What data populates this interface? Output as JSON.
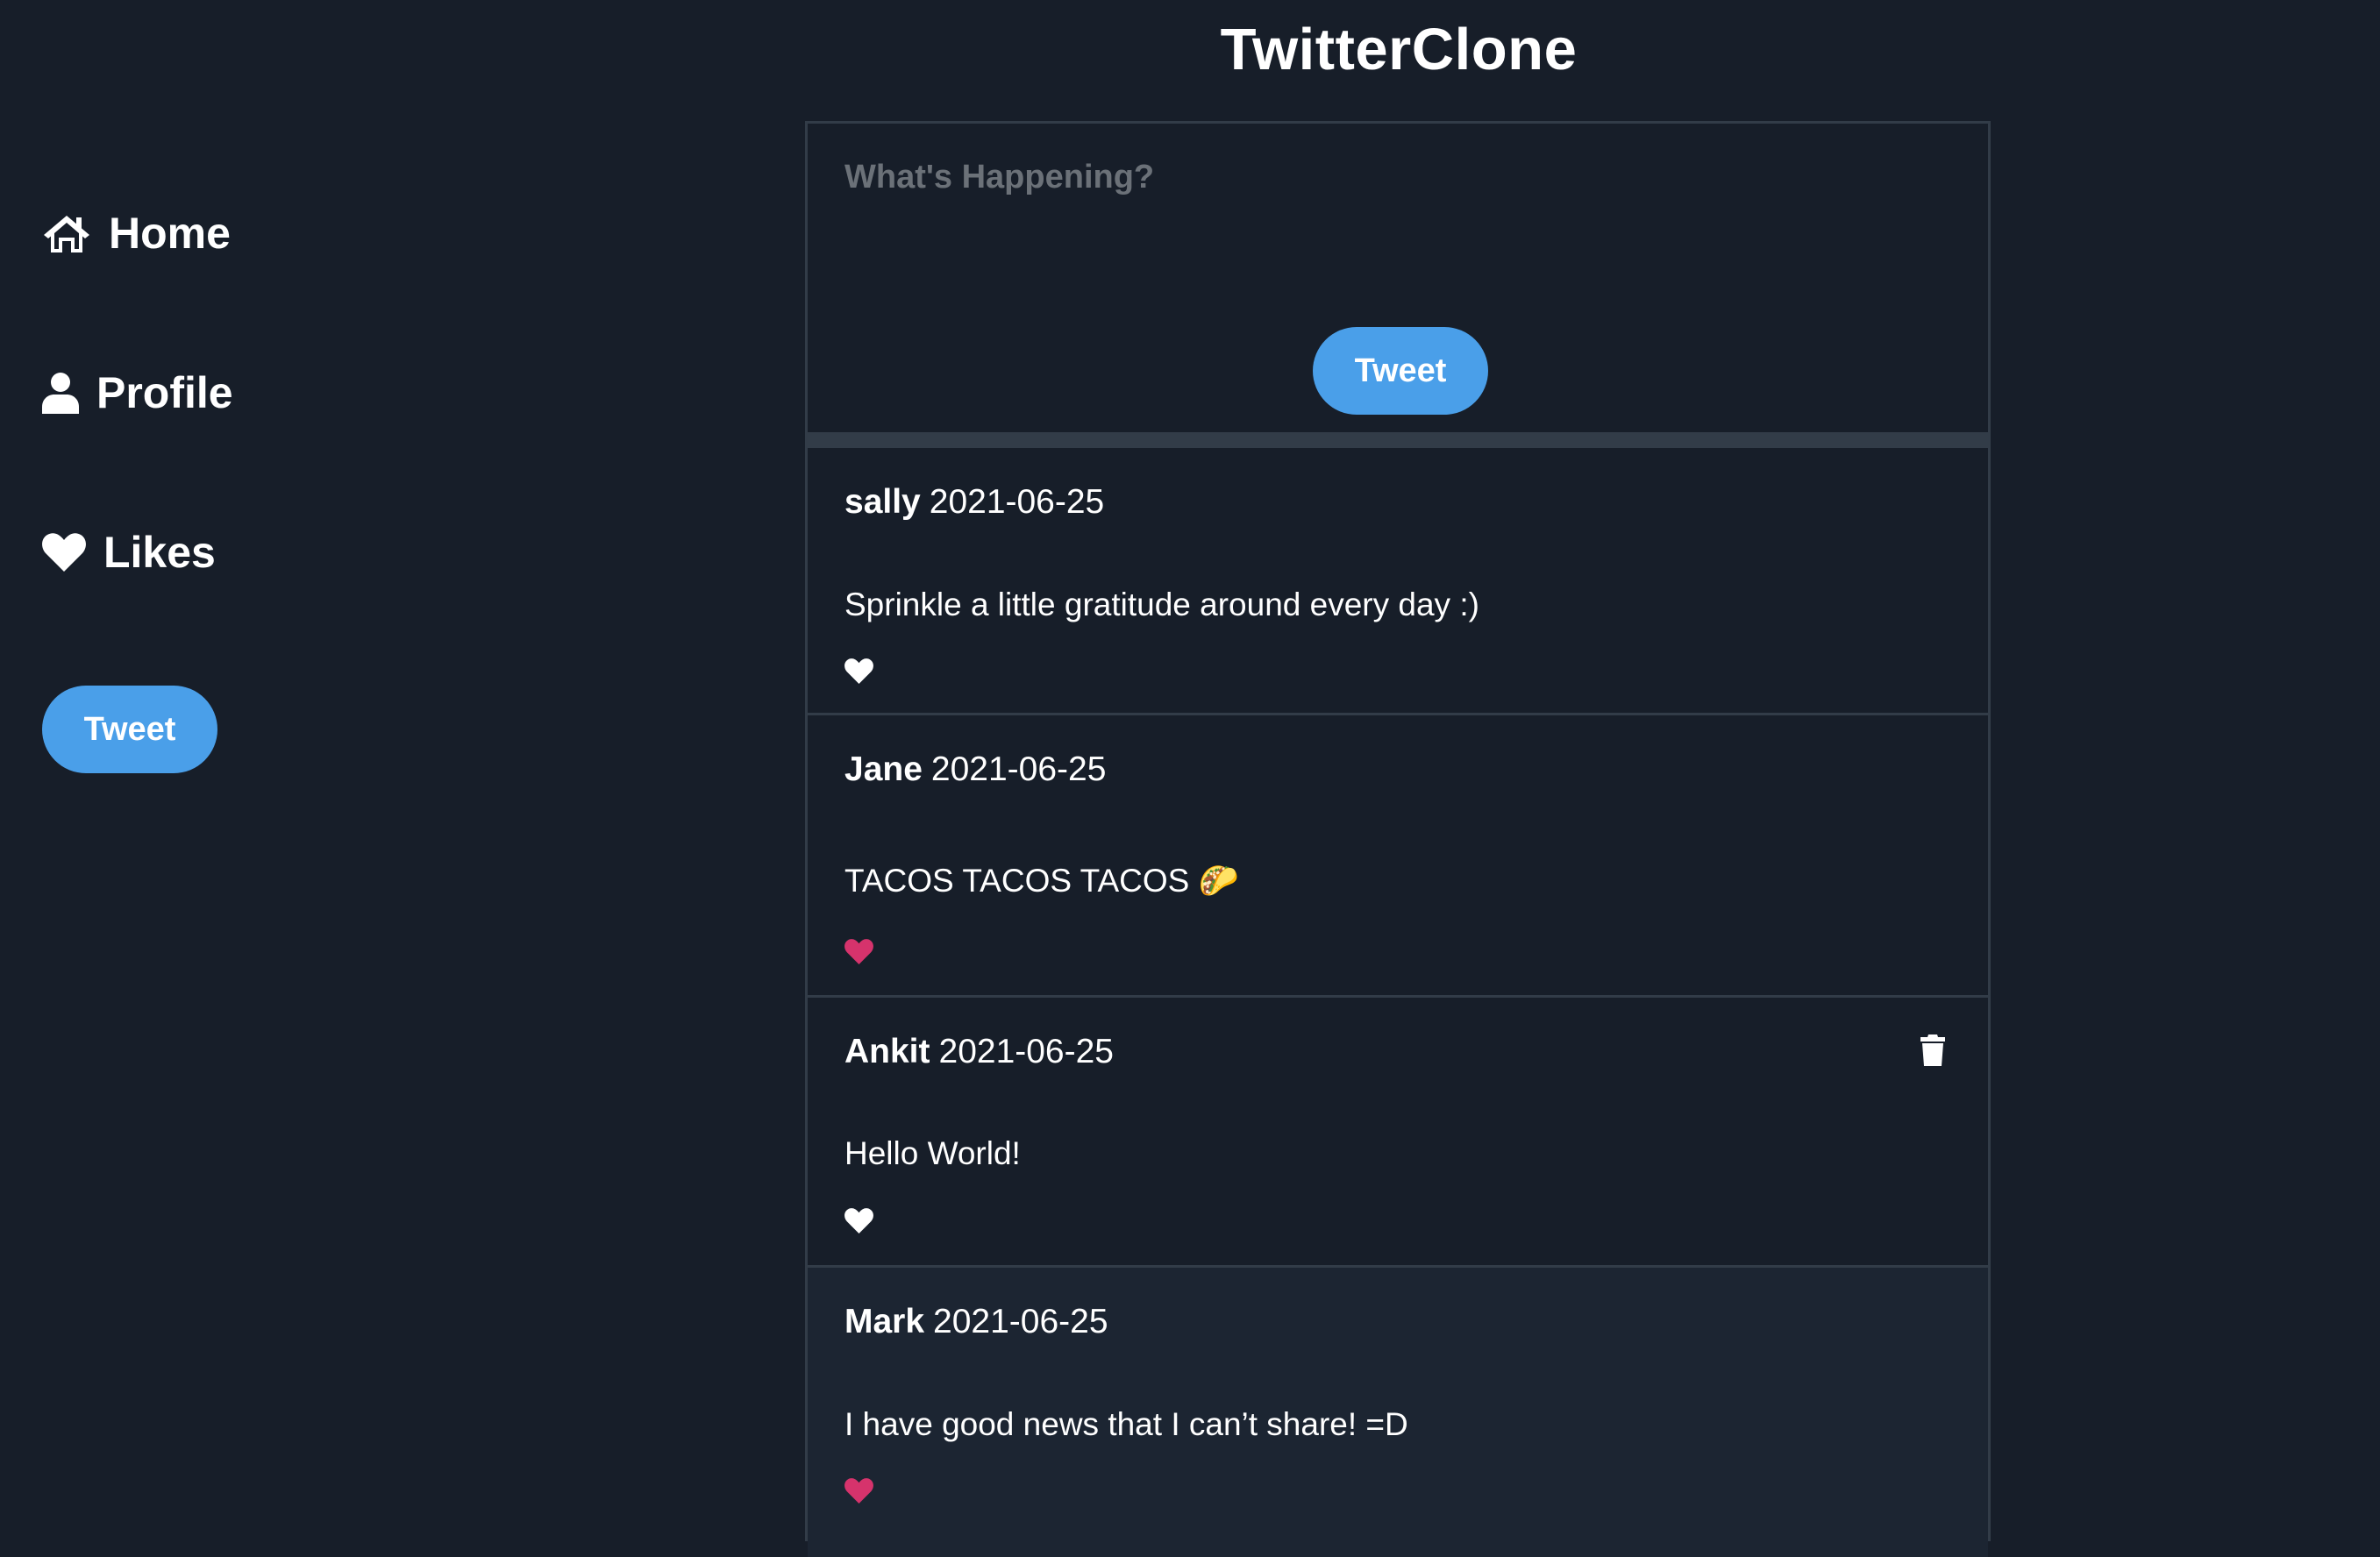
{
  "app": {
    "title": "TwitterClone"
  },
  "sidebar": {
    "items": [
      {
        "label": "Home",
        "icon": "home-icon"
      },
      {
        "label": "Profile",
        "icon": "user-icon"
      },
      {
        "label": "Likes",
        "icon": "heart-icon"
      }
    ],
    "tweet_button": "Tweet"
  },
  "composer": {
    "placeholder": "What's Happening?",
    "value": "",
    "tweet_button": "Tweet"
  },
  "colors": {
    "background": "#171e29",
    "accent": "#4a9fe9",
    "liked": "#d6336c",
    "border": "#323c48"
  },
  "tweets": [
    {
      "author": "sally",
      "date": "2021-06-25",
      "text": "Sprinkle a little gratitude around every day :)",
      "liked": false,
      "deletable": false
    },
    {
      "author": "Jane",
      "date": "2021-06-25",
      "text": "TACOS TACOS TACOS 🌮",
      "liked": true,
      "deletable": false
    },
    {
      "author": "Ankit",
      "date": "2021-06-25",
      "text": "Hello World!",
      "liked": false,
      "deletable": true
    },
    {
      "author": "Mark",
      "date": "2021-06-25",
      "text": "I have good news that I can’t share! =D",
      "liked": true,
      "deletable": false
    }
  ]
}
